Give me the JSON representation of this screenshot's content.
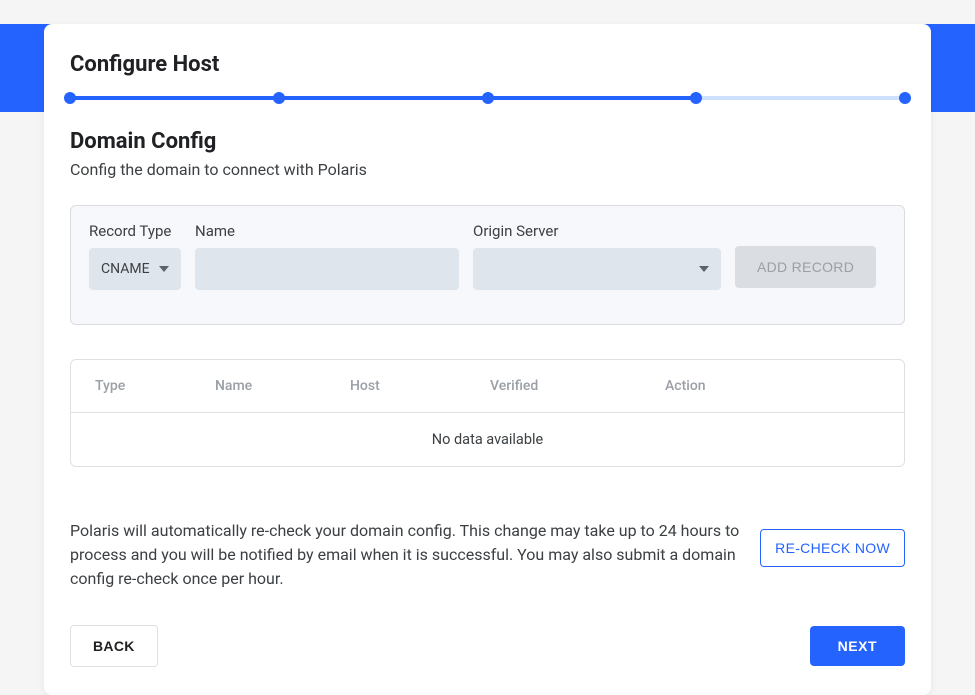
{
  "header": {
    "title": "Configure Host"
  },
  "stepper": {
    "total_steps": 5,
    "current_step": 4
  },
  "section": {
    "title": "Domain Config",
    "subtitle": "Config the domain to connect with Polaris"
  },
  "record_form": {
    "type_label": "Record Type",
    "type_value": "CNAME",
    "name_label": "Name",
    "name_value": "",
    "origin_label": "Origin Server",
    "origin_value": "",
    "add_button": "ADD RECORD"
  },
  "table": {
    "columns": [
      "Type",
      "Name",
      "Host",
      "Verified",
      "Action"
    ],
    "empty_text": "No data available"
  },
  "info": {
    "text": "Polaris will automatically re-check your domain config. This change may take up to 24 hours to process and you will be notified by email when it is successful. You may also submit a domain config re-check once per hour.",
    "recheck_button": "RE-CHECK NOW"
  },
  "footer": {
    "back": "BACK",
    "next": "NEXT"
  }
}
